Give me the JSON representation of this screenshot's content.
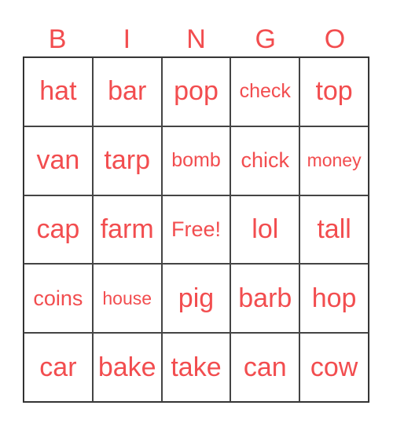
{
  "header": [
    "B",
    "I",
    "N",
    "G",
    "O"
  ],
  "accent_color": "#f24d4f",
  "cells": [
    [
      "hat",
      "bar",
      "pop",
      "check",
      "top"
    ],
    [
      "van",
      "tarp",
      "bomb",
      "chick",
      "money"
    ],
    [
      "cap",
      "farm",
      "Free!",
      "lol",
      "tall"
    ],
    [
      "coins",
      "house",
      "pig",
      "barb",
      "hop"
    ],
    [
      "car",
      "bake",
      "take",
      "can",
      "cow"
    ]
  ]
}
